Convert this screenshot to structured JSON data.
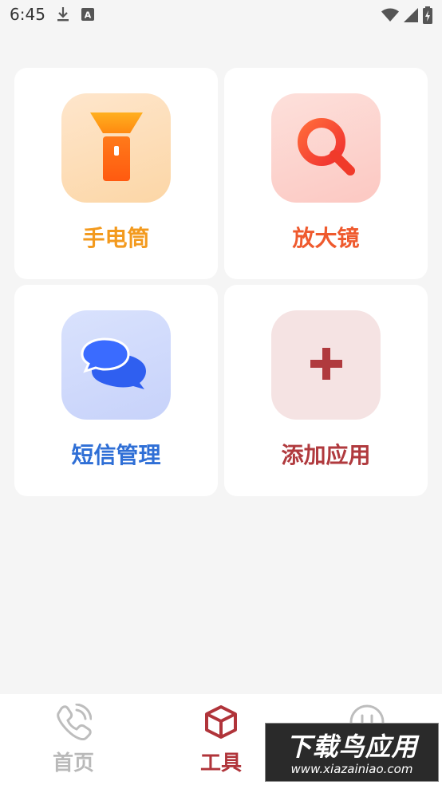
{
  "status_bar": {
    "time": "6:45",
    "icons_left": [
      "download-icon",
      "text-a-icon"
    ],
    "icons_right": [
      "wifi-icon",
      "signal-icon",
      "battery-charging-icon"
    ]
  },
  "tools": [
    {
      "label": "手电筒",
      "label_color": "#f39a1e",
      "tile_color": "#fde0c0",
      "icon": "flashlight-icon"
    },
    {
      "label": "放大镜",
      "label_color": "#ef5a2e",
      "tile_color": "#fdd3ce",
      "icon": "magnifier-icon"
    },
    {
      "label": "短信管理",
      "label_color": "#2f6fd6",
      "tile_color": "#d4ddfb",
      "icon": "chat-bubbles-icon"
    },
    {
      "label": "添加应用",
      "label_color": "#b03a3e",
      "tile_color": "#f5e3e3",
      "icon": "plus-icon"
    }
  ],
  "bottom_nav": {
    "items": [
      {
        "label": "首页",
        "icon": "phone-icon",
        "active": false
      },
      {
        "label": "工具",
        "icon": "cube-icon",
        "active": true
      }
    ],
    "active_color": "#b0343a",
    "inactive_color": "#b9b9b9"
  },
  "watermark": {
    "title": "下载鸟应用",
    "url": "www.xiazainiao.com"
  }
}
